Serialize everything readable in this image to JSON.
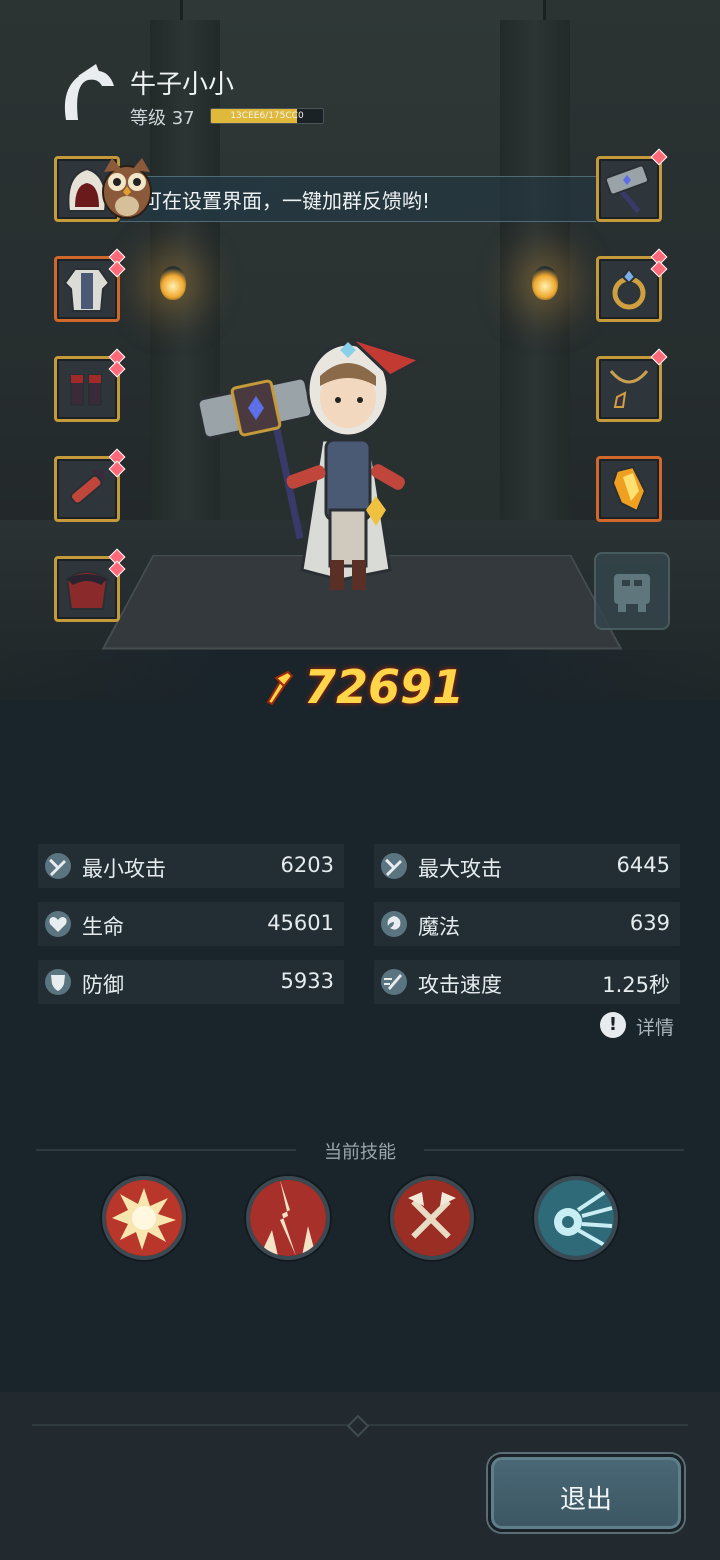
{
  "player": {
    "name": "牛子小小",
    "level_label": "等级 37",
    "exp_text": "13CEE6/175CC0",
    "exp_progress": 0.77
  },
  "notice": {
    "text": "可在设置界面，一键加群反馈哟!"
  },
  "equipment": {
    "left": [
      "hood-icon",
      "robe-icon",
      "boots-icon",
      "bracer-icon",
      "cape-icon"
    ],
    "right": [
      "hammer-icon",
      "ring-icon",
      "necklace-icon",
      "crystal-icon"
    ],
    "mount": "mount-icon"
  },
  "power": {
    "value": "72691"
  },
  "stats": [
    {
      "label": "最小攻击",
      "value": "6203",
      "icon": "sword-icon"
    },
    {
      "label": "最大攻击",
      "value": "6445",
      "icon": "sword-icon"
    },
    {
      "label": "生命",
      "value": "45601",
      "icon": "heart-icon"
    },
    {
      "label": "魔法",
      "value": "639",
      "icon": "magic-icon"
    },
    {
      "label": "防御",
      "value": "5933",
      "icon": "shield-icon"
    },
    {
      "label": "攻击速度",
      "value": "1.25秒",
      "icon": "speed-icon"
    }
  ],
  "details_label": "详情",
  "skills": {
    "title": "当前技能",
    "items": [
      "explosion-skill-icon",
      "lightning-skill-icon",
      "crossed-axes-skill-icon",
      "energy-orb-skill-icon"
    ]
  },
  "footer": {
    "exit_label": "退出"
  },
  "colors": {
    "gold": "#ffd54a",
    "frame": "#c59a3a",
    "frame_orange": "#d0682c",
    "button": "#4a6876"
  }
}
